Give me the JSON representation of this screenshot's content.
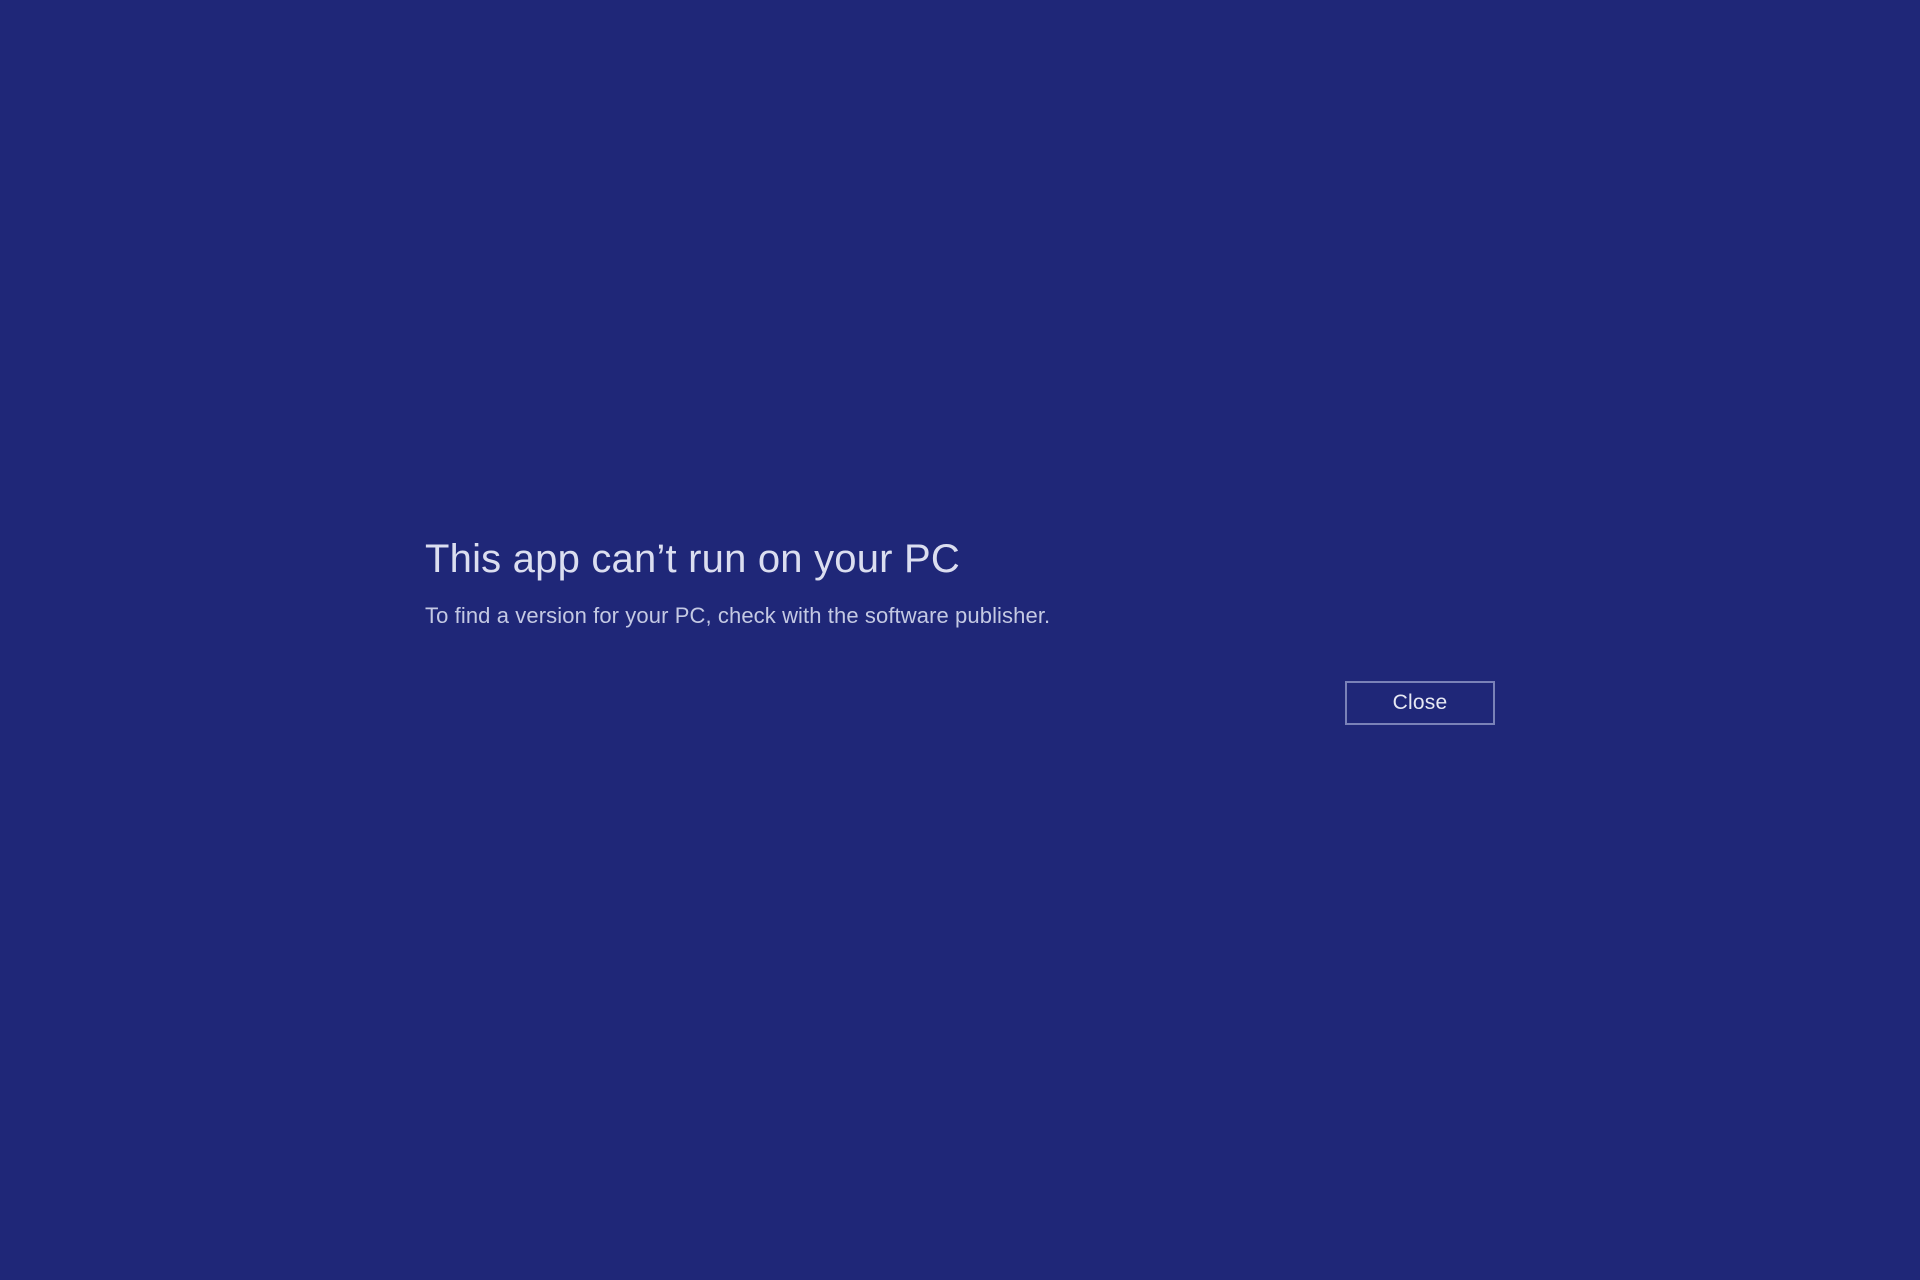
{
  "dialog": {
    "heading": "This app can’t run on your PC",
    "subtext": "To find a version for your PC, check with the software publisher.",
    "close_label": "Close"
  },
  "colors": {
    "background": "#1f2778",
    "text_primary": "#dbdef0",
    "text_secondary": "#c4c9e3",
    "button_border": "#7a82b8"
  }
}
